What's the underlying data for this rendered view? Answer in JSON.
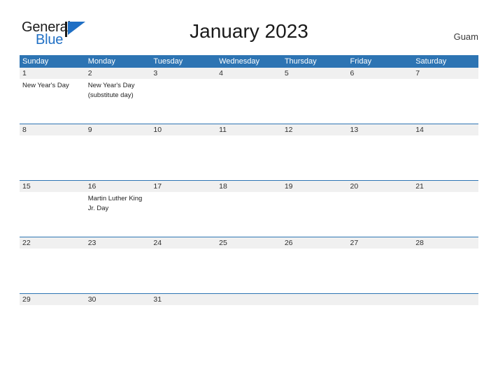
{
  "branding": {
    "logo_primary": "General",
    "logo_secondary": "Blue",
    "logo_icon": "blue-triangle-flag-icon",
    "accent_color": "#1f6fc4"
  },
  "header": {
    "title": "January 2023",
    "country": "Guam"
  },
  "colors": {
    "header_blue": "#2d74b3",
    "band_grey": "#f0f0f0",
    "text_dark": "#2e2e2e",
    "logo_blue": "#1f6fc4"
  },
  "calendar": {
    "month": "January",
    "year": "2023",
    "weekdays": [
      "Sunday",
      "Monday",
      "Tuesday",
      "Wednesday",
      "Thursday",
      "Friday",
      "Saturday"
    ],
    "weeks": [
      {
        "days": [
          {
            "number": "1",
            "events": [
              "New Year's Day"
            ]
          },
          {
            "number": "2",
            "events": [
              "New Year's Day",
              "(substitute day)"
            ]
          },
          {
            "number": "3",
            "events": []
          },
          {
            "number": "4",
            "events": []
          },
          {
            "number": "5",
            "events": []
          },
          {
            "number": "6",
            "events": []
          },
          {
            "number": "7",
            "events": []
          }
        ]
      },
      {
        "days": [
          {
            "number": "8",
            "events": []
          },
          {
            "number": "9",
            "events": []
          },
          {
            "number": "10",
            "events": []
          },
          {
            "number": "11",
            "events": []
          },
          {
            "number": "12",
            "events": []
          },
          {
            "number": "13",
            "events": []
          },
          {
            "number": "14",
            "events": []
          }
        ]
      },
      {
        "days": [
          {
            "number": "15",
            "events": []
          },
          {
            "number": "16",
            "events": [
              "Martin Luther King",
              "Jr. Day"
            ]
          },
          {
            "number": "17",
            "events": []
          },
          {
            "number": "18",
            "events": []
          },
          {
            "number": "19",
            "events": []
          },
          {
            "number": "20",
            "events": []
          },
          {
            "number": "21",
            "events": []
          }
        ]
      },
      {
        "days": [
          {
            "number": "22",
            "events": []
          },
          {
            "number": "23",
            "events": []
          },
          {
            "number": "24",
            "events": []
          },
          {
            "number": "25",
            "events": []
          },
          {
            "number": "26",
            "events": []
          },
          {
            "number": "27",
            "events": []
          },
          {
            "number": "28",
            "events": []
          }
        ]
      },
      {
        "days": [
          {
            "number": "29",
            "events": []
          },
          {
            "number": "30",
            "events": []
          },
          {
            "number": "31",
            "events": []
          },
          {
            "number": "",
            "events": []
          },
          {
            "number": "",
            "events": []
          },
          {
            "number": "",
            "events": []
          },
          {
            "number": "",
            "events": []
          }
        ]
      }
    ]
  }
}
